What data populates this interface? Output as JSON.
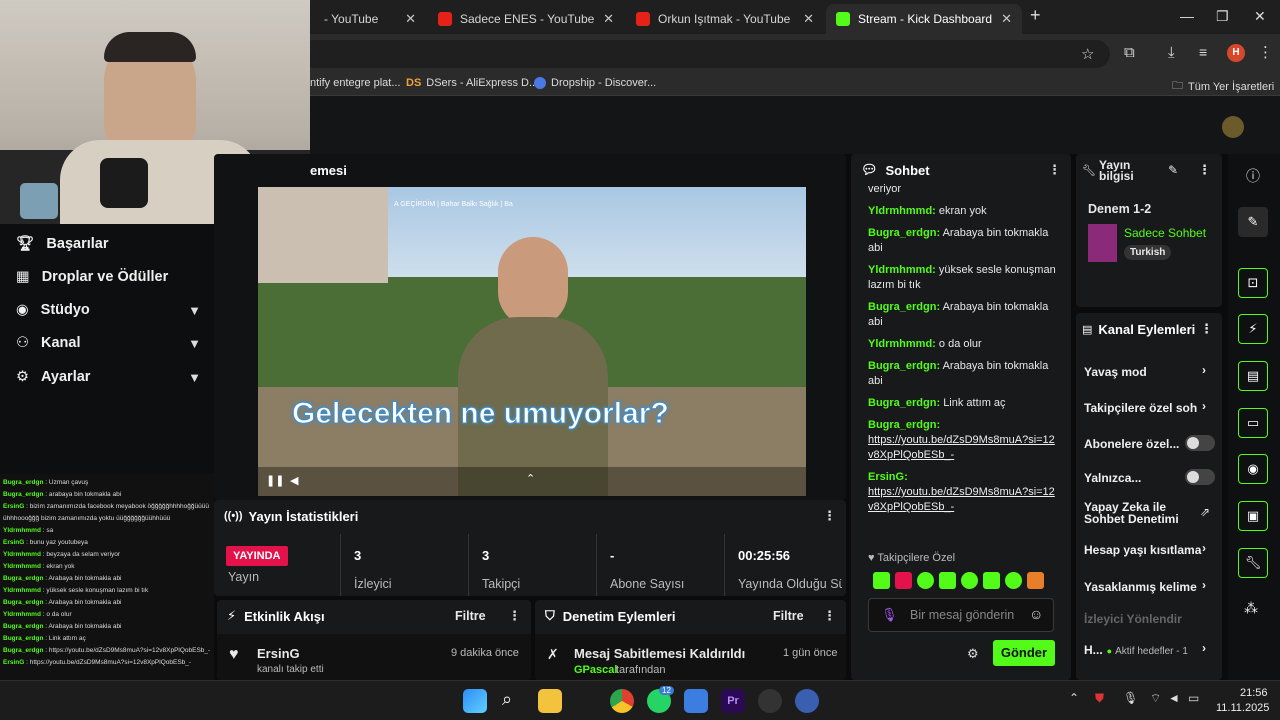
{
  "browser": {
    "tabs": [
      {
        "label": "- YouTube",
        "icon": "youtube-icon"
      },
      {
        "label": "Sadece ENES - YouTube",
        "icon": "youtube-icon"
      },
      {
        "label": "Orkun Işıtmak - YouTube",
        "icon": "youtube-icon"
      },
      {
        "label": "Stream - Kick Dashboard",
        "icon": "kick-icon"
      }
    ],
    "bookmarks": [
      {
        "label": "ntify entegre plat..."
      },
      {
        "label": "DSers - AliExpress D..."
      },
      {
        "label": "Dropship - Discover..."
      },
      {
        "label": "Tüm Yer İşaretleri"
      }
    ],
    "profile_initial": "H"
  },
  "sidebar": {
    "items": [
      {
        "label": "Başarılar",
        "icon": "trophy-icon"
      },
      {
        "label": "Droplar ve Ödüller",
        "icon": "gift-icon"
      },
      {
        "label": "Stüdyo",
        "icon": "studio-icon"
      },
      {
        "label": "Kanal",
        "icon": "users-icon"
      },
      {
        "label": "Ayarlar",
        "icon": "gear-icon"
      }
    ]
  },
  "overlay_chat": [
    {
      "u": "Bugra_erdgn",
      "t": "Uzman çavuş"
    },
    {
      "u": "Bugra_erdgn",
      "t": "arabaya bin tokmakla abi"
    },
    {
      "u": "ErsinG",
      "t": "bizim zamanımızda facebook meyabook öğğğğğhhhhoğğüüüü ühhhoooğğğ bizim zamanımızda yoktu üüğğğğğğüühhüüü"
    },
    {
      "u": "Yldrmhmmd",
      "t": "sa"
    },
    {
      "u": "ErsinG",
      "t": "bunu yaz youtubeya"
    },
    {
      "u": "Yldrmhmmd",
      "t": "beyzaya da selam veriyor"
    },
    {
      "u": "Yldrmhmmd",
      "t": "ekran yok"
    },
    {
      "u": "Bugra_erdgn",
      "t": "Arabaya bin tokmakla abi"
    },
    {
      "u": "Yldrmhmmd",
      "t": "yüksek sesle konuşman lazım bi tık"
    },
    {
      "u": "Bugra_erdgn",
      "t": "Arabaya bin tokmakla abi"
    },
    {
      "u": "Yldrmhmmd",
      "t": "o da olur"
    },
    {
      "u": "Bugra_erdgn",
      "t": "Arabaya bin tokmakla abi"
    },
    {
      "u": "Bugra_erdgn",
      "t": "Link attım aç"
    },
    {
      "u": "Bugra_erdgn",
      "t": "https://youtu.be/dZsD9Ms8muA?si=12v8XpPlQobESb_-"
    },
    {
      "u": "ErsinG",
      "t": "https://youtu.be/dZsD9Ms8muA?si=12v8XpPlQobESb_-"
    }
  ],
  "video": {
    "panel_title": "emesi",
    "caption": "Gelecekten ne umuyorlar?",
    "top_caption": "A GEÇİRDİM | Bahar Balkı Sağlık | Ba"
  },
  "stats": {
    "title": "Yayın İstatistikleri",
    "live_badge": "YAYINDA",
    "cells": [
      {
        "v": "",
        "l": "Yayın"
      },
      {
        "v": "3",
        "l": "İzleyici"
      },
      {
        "v": "3",
        "l": "Takipçi"
      },
      {
        "v": "-",
        "l": "Abone Sayısı"
      },
      {
        "v": "00:25:56",
        "l": "Yayında Olduğu Süre"
      }
    ]
  },
  "activity": {
    "title": "Etkinlik Akışı",
    "filter": "Filtre",
    "item_user": "ErsinG",
    "item_desc": "kanalı takip etti",
    "item_time": "9 dakika önce"
  },
  "moderation": {
    "title": "Denetim Eylemleri",
    "filter": "Filtre",
    "item_title": "Mesaj Sabitlemesi Kaldırıldı",
    "item_user": "GPascal",
    "item_suffix": "tarafından",
    "item_time": "1 gün önce"
  },
  "chat": {
    "title": "Sohbet",
    "partial_top": "veriyor",
    "messages": [
      {
        "u": "Yldrmhmmd:",
        "t": "ekran yok"
      },
      {
        "u": "Bugra_erdgn:",
        "t": "Arabaya bin tokmakla abi"
      },
      {
        "u": "Yldrmhmmd:",
        "t": "yüksek sesle konuşman lazım bi tık"
      },
      {
        "u": "Bugra_erdgn:",
        "t": "Arabaya bin tokmakla abi"
      },
      {
        "u": "Yldrmhmmd:",
        "t": "o da olur"
      },
      {
        "u": "Bugra_erdgn:",
        "t": "Arabaya bin tokmakla abi"
      },
      {
        "u": "Bugra_erdgn:",
        "t": "Link attım aç"
      }
    ],
    "link_messages": [
      {
        "u": "Bugra_erdgn:",
        "link": "https://youtu.be/dZsD9Ms8muA?si=12v8XpPlQobESb_-"
      },
      {
        "u": "ErsinG:",
        "link": "https://youtu.be/dZsD9Ms8muA?si=12v8XpPlQobESb_-"
      }
    ],
    "follower_only": "Takipçilere Özel",
    "input_placeholder": "Bir mesaj gönderin",
    "send_label": "Gönder"
  },
  "stream_info": {
    "title": "Yayın bilgisi",
    "stream_title": "Denem 1-2",
    "category": "Sadece Sohbet",
    "language": "Turkish"
  },
  "channel_actions": {
    "title": "Kanal Eylemleri",
    "items": [
      {
        "label": "Yavaş mod"
      },
      {
        "label": "Takipçilere özel soh"
      },
      {
        "label": "Abonelere özel..."
      },
      {
        "label": "Yalnızca..."
      },
      {
        "label": "Yapay Zeka ile Sohbet Denetimi"
      },
      {
        "label": "Hesap yaşı kısıtlama"
      },
      {
        "label": "Yasaklanmış kelime"
      },
      {
        "label": "İzleyici Yönlendir"
      },
      {
        "label": "H..."
      }
    ],
    "active_goals": "Aktif hedefler - 1"
  },
  "taskbar": {
    "time": "21:56",
    "date": "11.11.2025",
    "whatsapp_badge": "12"
  },
  "colors": {
    "accent": "#53fc18",
    "live": "#e3124a"
  }
}
